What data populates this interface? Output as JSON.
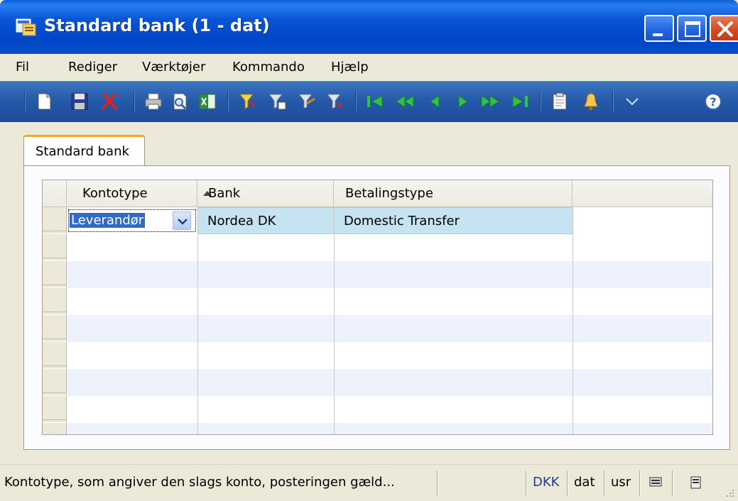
{
  "window": {
    "title": "Standard bank (1 - dat)",
    "icon": "app-icon"
  },
  "menu": {
    "items": [
      "Fil",
      "Rediger",
      "Værktøjer",
      "Kommando",
      "Hjælp"
    ]
  },
  "toolbar": {
    "icons": [
      "new-icon",
      "save-icon",
      "delete-icon",
      "print-icon",
      "print-preview-icon",
      "excel-icon",
      "filter-field-icon",
      "filter-table-icon",
      "flow-filter-icon",
      "clear-filter-icon",
      "first-record-icon",
      "previous-page-icon",
      "previous-record-icon",
      "next-record-icon",
      "next-page-icon",
      "last-record-icon",
      "clipboard-icon",
      "alert-icon",
      "help-icon"
    ]
  },
  "tab": {
    "label": "Standard bank"
  },
  "grid": {
    "columns": [
      "Kontotype",
      "Bank",
      "Betalingstype"
    ],
    "sort_column": "Kontotype",
    "sort_direction": "ascending",
    "rows": [
      {
        "kontotype": "Leverandør",
        "bank": "Nordea DK",
        "betalingstype": "Domestic Transfer"
      }
    ]
  },
  "statusbar": {
    "message": "Kontotype, som angiver den slags konto, posteringen gæld...",
    "currency": "DKK",
    "company": "dat",
    "user": "usr"
  },
  "colors": {
    "title_bar": "#0a55d6",
    "toolbar": "#2458a8",
    "tab_accent": "#f5a623",
    "row_alt": "#eef2fc",
    "selection": "#c6e3f2"
  }
}
